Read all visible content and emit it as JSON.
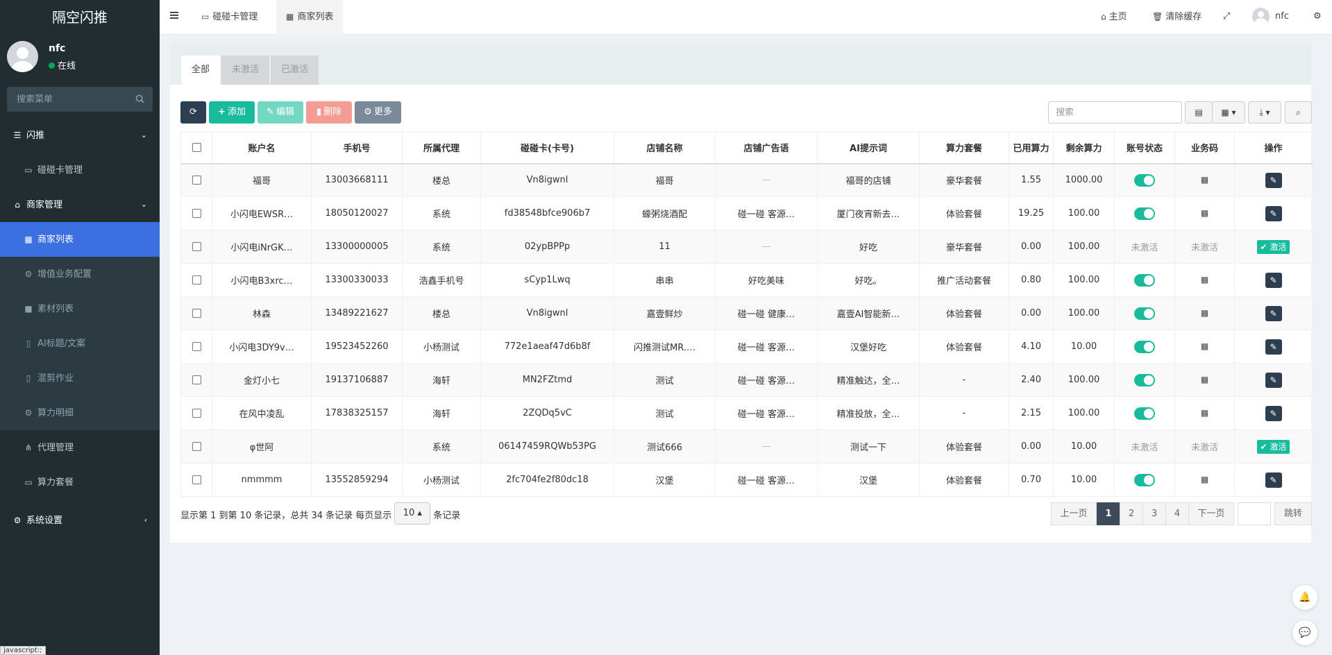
{
  "brand": "隔空闪推",
  "user": {
    "name": "nfc",
    "status": "在线"
  },
  "sidebar": {
    "search_placeholder": "搜索菜单",
    "items": [
      {
        "label": "闪推",
        "icon": "list-icon"
      },
      {
        "label": "碰碰卡管理",
        "icon": "card-icon"
      },
      {
        "label": "商家管理",
        "icon": "bank-icon"
      },
      {
        "label": "商家列表",
        "icon": "grid-icon"
      },
      {
        "label": "增值业务配置",
        "icon": "cogs-icon"
      },
      {
        "label": "素材列表",
        "icon": "video-icon"
      },
      {
        "label": "AI标题/文案",
        "icon": "file-icon"
      },
      {
        "label": "混剪作业",
        "icon": "file-icon"
      },
      {
        "label": "算力明细",
        "icon": "gear-icon"
      },
      {
        "label": "代理管理",
        "icon": "sitemap-icon"
      },
      {
        "label": "算力套餐",
        "icon": "card-icon"
      },
      {
        "label": "系统设置",
        "icon": "cogs-icon"
      }
    ]
  },
  "topbar": {
    "tabs": [
      {
        "label": "碰碰卡管理"
      },
      {
        "label": "商家列表"
      }
    ],
    "home": "主页",
    "clear_cache": "清除缓存",
    "username": "nfc"
  },
  "panel_tabs": [
    "全部",
    "未激活",
    "已激活"
  ],
  "toolbar": {
    "add": "添加",
    "edit": "编辑",
    "delete": "删除",
    "more": "更多",
    "search_placeholder": "搜索"
  },
  "colors": {
    "sidebar_bg": "#222d32",
    "active_menu": "#3c70e0",
    "btn_refresh": "#2c3e50",
    "btn_add": "#18bc9c",
    "btn_edit": "#74d7c3",
    "btn_delete": "#f39c94",
    "btn_more": "#7b8a9a",
    "switch_on": "#18bc9c"
  },
  "table": {
    "headers": [
      "账户名",
      "手机号",
      "所属代理",
      "碰碰卡(卡号)",
      "店铺名称",
      "店铺广告语",
      "AI提示词",
      "算力套餐",
      "已用算力",
      "剩余算力",
      "账号状态",
      "业务码",
      "操作"
    ],
    "rows": [
      [
        "福哥",
        "13003668111",
        "楼总",
        "Vn8igwnl",
        "福哥",
        "—",
        "福哥的店铺",
        "豪华套餐",
        "1.55",
        "1000.00",
        "on",
        "qr",
        "edit"
      ],
      [
        "小闪电EWSR…",
        "18050120027",
        "系统",
        "fd38548bfce906b7",
        "蠔粥烧酒配",
        "碰一碰 客源…",
        "厦门夜宵新去…",
        "体验套餐",
        "19.25",
        "100.00",
        "on",
        "qr",
        "edit"
      ],
      [
        "小闪电iNrGK…",
        "13300000005",
        "系统",
        "02ypBPPp",
        "11",
        "—",
        "好吃",
        "豪华套餐",
        "0.00",
        "100.00",
        "未激活",
        "未激活",
        "激活"
      ],
      [
        "小闪电B3xrc…",
        "13300330033",
        "浩鑫手机号",
        "sCyp1Lwq",
        "串串",
        "好吃美味",
        "好吃。",
        "推广活动套餐",
        "0.80",
        "100.00",
        "on",
        "qr",
        "edit"
      ],
      [
        "林森",
        "13489221627",
        "楼总",
        "Vn8igwnl",
        "嘉壹鲜炒",
        "碰一碰 健康…",
        "嘉壹AI智能新…",
        "体验套餐",
        "0.00",
        "100.00",
        "on",
        "qr",
        "edit"
      ],
      [
        "小闪电3DY9v…",
        "19523452260",
        "小杨测试",
        "772e1aeaf47d6b8f",
        "闪推测试MR.…",
        "碰一碰 客源…",
        "汉堡好吃",
        "体验套餐",
        "4.10",
        "10.00",
        "on",
        "qr",
        "edit"
      ],
      [
        "金灯小七",
        "19137106887",
        "海轩",
        "MN2FZtmd",
        "测试",
        "碰一碰 客源…",
        "精准触达，全…",
        "-",
        "2.40",
        "100.00",
        "on",
        "qr",
        "edit"
      ],
      [
        "在风中凌乱",
        "17838325157",
        "海轩",
        "2ZQDq5vC",
        "测试",
        "碰一碰 客源…",
        "精准投放，全…",
        "-",
        "2.15",
        "100.00",
        "on",
        "qr",
        "edit"
      ],
      [
        "φ世阿",
        "",
        "系统",
        "06147459RQWb53PG",
        "测试666",
        "—",
        "测试一下",
        "体验套餐",
        "0.00",
        "10.00",
        "未激活",
        "未激活",
        "激活"
      ],
      [
        "nmmmm",
        "13552859294",
        "小杨测试",
        "2fc704fe2f80dc18",
        "汉堡",
        "碰一碰 客源…",
        "汉堡",
        "体验套餐",
        "0.70",
        "10.00",
        "on",
        "qr",
        "edit"
      ]
    ]
  },
  "footer": {
    "info_prefix": "显示第 1 到第 10 条记录，总共 34 条记录 每页显示",
    "page_size": "10",
    "info_suffix": "条记录",
    "prev": "上一页",
    "pages": [
      "1",
      "2",
      "3",
      "4"
    ],
    "next": "下一页",
    "jump": "跳转"
  },
  "status_tip": "javascript:;"
}
